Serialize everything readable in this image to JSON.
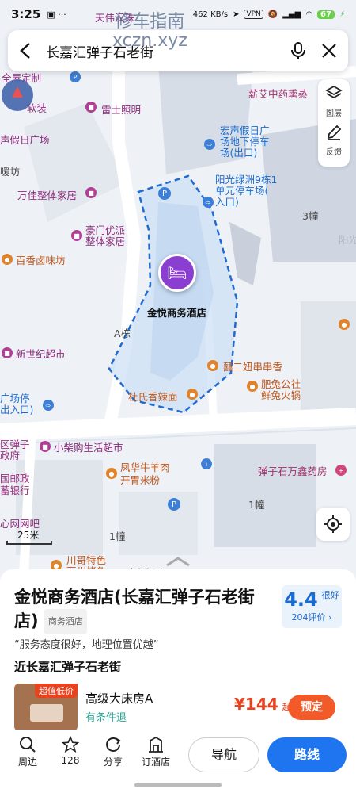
{
  "status": {
    "time": "3:25",
    "net": "462 KB/s",
    "battery": "67"
  },
  "watermark": {
    "line1": "修车指南",
    "line2": "xczn.xyz"
  },
  "search": {
    "query": "长嘉汇弹子石老街"
  },
  "side": {
    "layers": "图层",
    "feedback": "反馈"
  },
  "map_labels": {
    "tianwei": "天伟汉珠",
    "quanwu": "全屋定制",
    "ruanzhuang": "软装",
    "leishi": "雷士照明",
    "jiaai": "薪艾中药熏蒸",
    "jiaridc": "声假日广场",
    "hongsheng_park": "宏声假日广\n场地下停车\n场(出口)",
    "jiefang": "嗳坊",
    "wanjia": "万佳整体家居",
    "yangguang": "阳光绿洲9栋1\n单元停车场(\n入口)",
    "b3": "3幢",
    "yang": "阳光",
    "haomen": "豪门优派\n整体家居",
    "baiji": "百香卤味坊",
    "hotel": "金悦商务酒店",
    "aling": "A栋",
    "xinshiji": "新世纪超市",
    "qiaoer": "囍二妞串串香",
    "feitu": "肥兔公社\n鲜兔火锅",
    "dushi": "杜氏香辣面",
    "guangchang": "广场停\n出入口)",
    "xiaochai": "小柴购生活超市",
    "qudanzi": "区弹子\n政府",
    "fenghua": "凤华牛羊肉\n开胃米粉",
    "wanxin": "弹子石万鑫药房",
    "guoyou": "国邮政\n蓄银行",
    "b1": "1幢",
    "wangba": "心网网吧",
    "b1b": "1幢",
    "scale": "25米",
    "chuange": "川哥特色\n万州烤鱼",
    "lu": "齐都江吉"
  },
  "place": {
    "name": "金悦商务酒店(长嘉汇弹子石老街店)",
    "type": "商务酒店",
    "rating": "4.4",
    "rating_word": "很好",
    "reviews": "204评价",
    "quote": "“服务态度很好，地理位置优越”",
    "near": "近长嘉汇弹子石老街"
  },
  "room": {
    "badge": "超值低价",
    "name": "高级大床房A",
    "cancel": "有条件退",
    "price": "¥144",
    "price_suffix": "起",
    "book": "预定"
  },
  "bottom": {
    "nearby": "周边",
    "fav": "128",
    "share": "分享",
    "book_hotel": "订酒店",
    "navigate": "导航",
    "route": "路线"
  }
}
